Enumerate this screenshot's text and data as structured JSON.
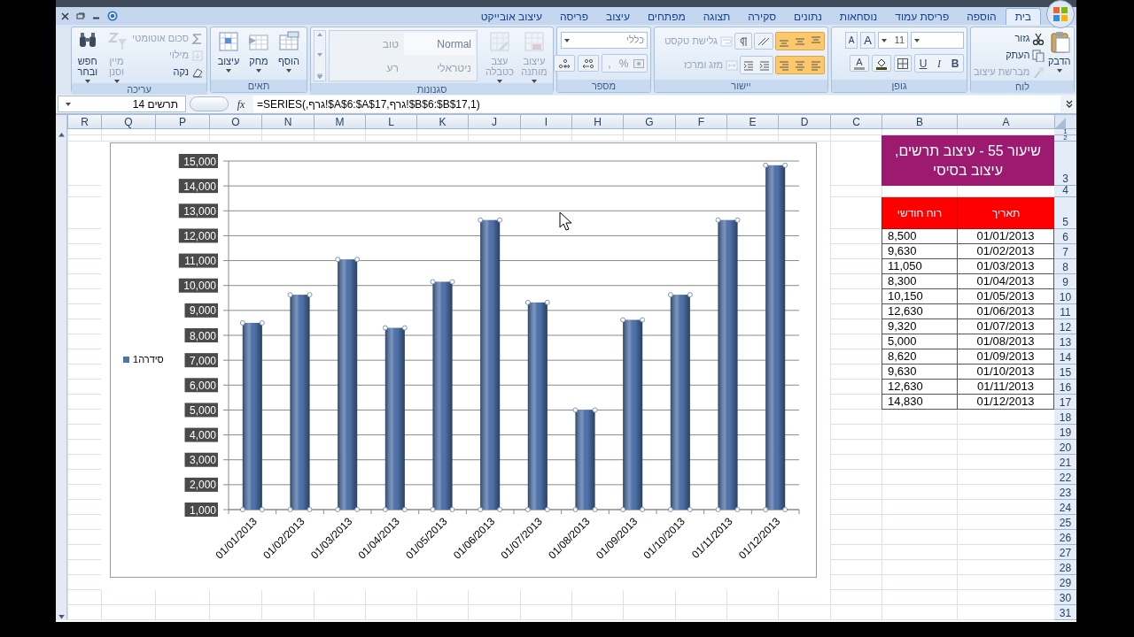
{
  "tabs": [
    {
      "label": "בית",
      "selected": true
    },
    {
      "label": "הוספה",
      "selected": false
    },
    {
      "label": "פריסת עמוד",
      "selected": false
    },
    {
      "label": "נוסחאות",
      "selected": false
    },
    {
      "label": "נתונים",
      "selected": false
    },
    {
      "label": "סקירה",
      "selected": false
    },
    {
      "label": "תצוגה",
      "selected": false
    },
    {
      "label": "מפתחים",
      "selected": false
    },
    {
      "label": "עיצוב",
      "selected": false
    },
    {
      "label": "פריסה",
      "selected": false
    },
    {
      "label": "עיצוב אובייקט",
      "selected": false
    }
  ],
  "ribbon": [
    {
      "kind": "clipboard",
      "label": "לוח",
      "paste": {
        "label": "הדבק",
        "disabled": false
      },
      "small": [
        {
          "label": "גזור",
          "disabled": false
        },
        {
          "label": "העתק",
          "disabled": false
        },
        {
          "label": "מברשת עיצוב",
          "disabled": true
        }
      ]
    },
    {
      "kind": "font",
      "label": "גופן",
      "font_size": "11",
      "size_buttons": [
        "A",
        "A"
      ],
      "style_buttons": [
        "B",
        "I",
        "U"
      ],
      "font_color_button": "A"
    },
    {
      "kind": "alignment",
      "label": "יישור",
      "alignment_highlighted": true,
      "small": [
        {
          "label": "גלישת טקסט",
          "disabled": true
        },
        {
          "label": "מזג ומרכז",
          "disabled": true
        }
      ]
    },
    {
      "kind": "number",
      "label": "מספר",
      "number_format": "כללי",
      "symbol_buttons": [
        "%",
        ","
      ]
    },
    {
      "kind": "styles",
      "label": "סגנונות",
      "large": [
        {
          "label": "עיצוב מותנה",
          "disabled": true
        },
        {
          "label": "עצב כטבלה",
          "disabled": true
        }
      ],
      "styles": [
        "Normal",
        "טוב",
        "ניטראלי",
        "רע"
      ]
    },
    {
      "kind": "cells",
      "label": "תאים",
      "large": [
        {
          "label": "הוסף",
          "disabled": false
        },
        {
          "label": "מחק",
          "disabled": false
        },
        {
          "label": "עיצוב",
          "disabled": false
        }
      ]
    },
    {
      "kind": "editing",
      "label": "עריכה",
      "small": [
        {
          "label": "סכום אוטומטי",
          "disabled": true
        },
        {
          "label": "מילוי",
          "disabled": true
        },
        {
          "label": "נקה",
          "disabled": false
        }
      ],
      "large": [
        {
          "label": "מיין וסנן",
          "disabled": true
        },
        {
          "label": "חפש ובחר",
          "disabled": false
        }
      ]
    }
  ],
  "formula_bar": {
    "name_box": "תרשים 14",
    "fx": "fx",
    "formula": "=SERIES(,גרף!$A$6:$A$17,גרף!$B$6:$B$17,1)"
  },
  "sheet": {
    "columns": [
      "A",
      "B",
      "C",
      "D",
      "E",
      "F",
      "G",
      "H",
      "I",
      "J",
      "K",
      "L",
      "M",
      "N",
      "O",
      "P",
      "Q",
      "R"
    ],
    "rows": [
      "1",
      "2",
      "3",
      "4",
      "5",
      "6",
      "7",
      "8",
      "9",
      "10",
      "11",
      "12",
      "13",
      "14",
      "15",
      "16",
      "17",
      "18",
      "19",
      "20",
      "21",
      "22",
      "23",
      "24",
      "25",
      "26",
      "27",
      "28",
      "29",
      "30",
      "31"
    ],
    "title": "שיעור 55 - עיצוב תרשים, עיצוב בסיסי",
    "headers": [
      "תאריך",
      "רוח חודשי"
    ],
    "data": [
      [
        "01/01/2013",
        "8,500"
      ],
      [
        "01/02/2013",
        "9,630"
      ],
      [
        "01/03/2013",
        "11,050"
      ],
      [
        "01/04/2013",
        "8,300"
      ],
      [
        "01/05/2013",
        "10,150"
      ],
      [
        "01/06/2013",
        "12,630"
      ],
      [
        "01/07/2013",
        "9,320"
      ],
      [
        "01/08/2013",
        "5,000"
      ],
      [
        "01/09/2013",
        "8,620"
      ],
      [
        "01/10/2013",
        "9,630"
      ],
      [
        "01/11/2013",
        "12,630"
      ],
      [
        "01/12/2013",
        "14,830"
      ]
    ]
  },
  "chart": {
    "chart_data": {
      "type": "bar",
      "grid": true,
      "categories": [
        "01/01/2013",
        "01/02/2013",
        "01/03/2013",
        "01/04/2013",
        "01/05/2013",
        "01/06/2013",
        "01/07/2013",
        "01/08/2013",
        "01/09/2013",
        "01/10/2013",
        "01/11/2013",
        "01/12/2013"
      ],
      "series": [
        {
          "name": "סידרה1",
          "color": "#4f74ad",
          "values": [
            8500,
            9630,
            11050,
            8300,
            10150,
            12630,
            9320,
            5000,
            8620,
            9630,
            12630,
            14830
          ]
        }
      ],
      "ylim": [
        1000,
        15000
      ],
      "yticks": [
        {
          "value": 1000,
          "label": "1,000"
        },
        {
          "value": 2000,
          "label": "2,000"
        },
        {
          "value": 3000,
          "label": "3,000"
        },
        {
          "value": 4000,
          "label": "4,000"
        },
        {
          "value": 5000,
          "label": "5,000"
        },
        {
          "value": 6000,
          "label": "6,000"
        },
        {
          "value": 7000,
          "label": "7,000"
        },
        {
          "value": 8000,
          "label": "8,000"
        },
        {
          "value": 9000,
          "label": "9,000"
        },
        {
          "value": 10000,
          "label": "10,000"
        },
        {
          "value": 11000,
          "label": "11,000"
        },
        {
          "value": 12000,
          "label": "12,000"
        },
        {
          "value": 13000,
          "label": "13,000"
        },
        {
          "value": 14000,
          "label": "14,000"
        },
        {
          "value": 15000,
          "label": "15,000"
        }
      ]
    }
  }
}
